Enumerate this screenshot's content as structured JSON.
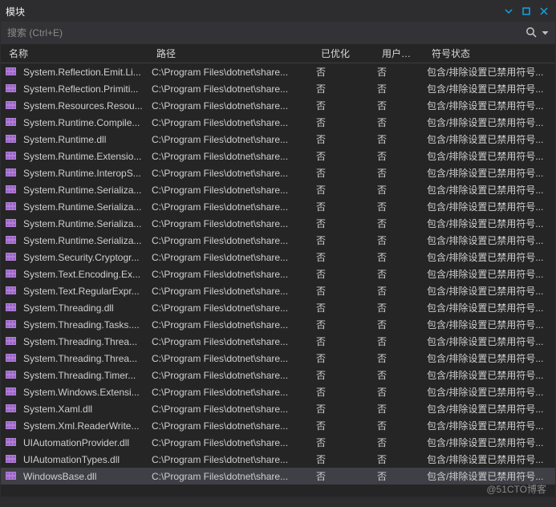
{
  "title": "模块",
  "search_placeholder": "搜索 (Ctrl+E)",
  "columns": {
    "name": "名称",
    "path": "路径",
    "optimized": "已优化",
    "usercode": "用户代码",
    "symbolstate": "符号状态"
  },
  "path_value": "C:\\Program Files\\dotnet\\share...",
  "opt_value": "否",
  "user_value": "否",
  "sym_value": "包含/排除设置已禁用符号...",
  "watermark": "@51CTO博客",
  "rows": [
    {
      "name": "System.Reflection.Emit.Li..."
    },
    {
      "name": "System.Reflection.Primiti..."
    },
    {
      "name": "System.Resources.Resou..."
    },
    {
      "name": "System.Runtime.Compile..."
    },
    {
      "name": "System.Runtime.dll"
    },
    {
      "name": "System.Runtime.Extensio..."
    },
    {
      "name": "System.Runtime.InteropS..."
    },
    {
      "name": "System.Runtime.Serializa..."
    },
    {
      "name": "System.Runtime.Serializa..."
    },
    {
      "name": "System.Runtime.Serializa..."
    },
    {
      "name": "System.Runtime.Serializa..."
    },
    {
      "name": "System.Security.Cryptogr..."
    },
    {
      "name": "System.Text.Encoding.Ex..."
    },
    {
      "name": "System.Text.RegularExpr..."
    },
    {
      "name": "System.Threading.dll"
    },
    {
      "name": "System.Threading.Tasks...."
    },
    {
      "name": "System.Threading.Threa..."
    },
    {
      "name": "System.Threading.Threa..."
    },
    {
      "name": "System.Threading.Timer..."
    },
    {
      "name": "System.Windows.Extensi..."
    },
    {
      "name": "System.Xaml.dll"
    },
    {
      "name": "System.Xml.ReaderWrite..."
    },
    {
      "name": "UIAutomationProvider.dll"
    },
    {
      "name": "UIAutomationTypes.dll"
    },
    {
      "name": "WindowsBase.dll",
      "selected": true
    }
  ]
}
